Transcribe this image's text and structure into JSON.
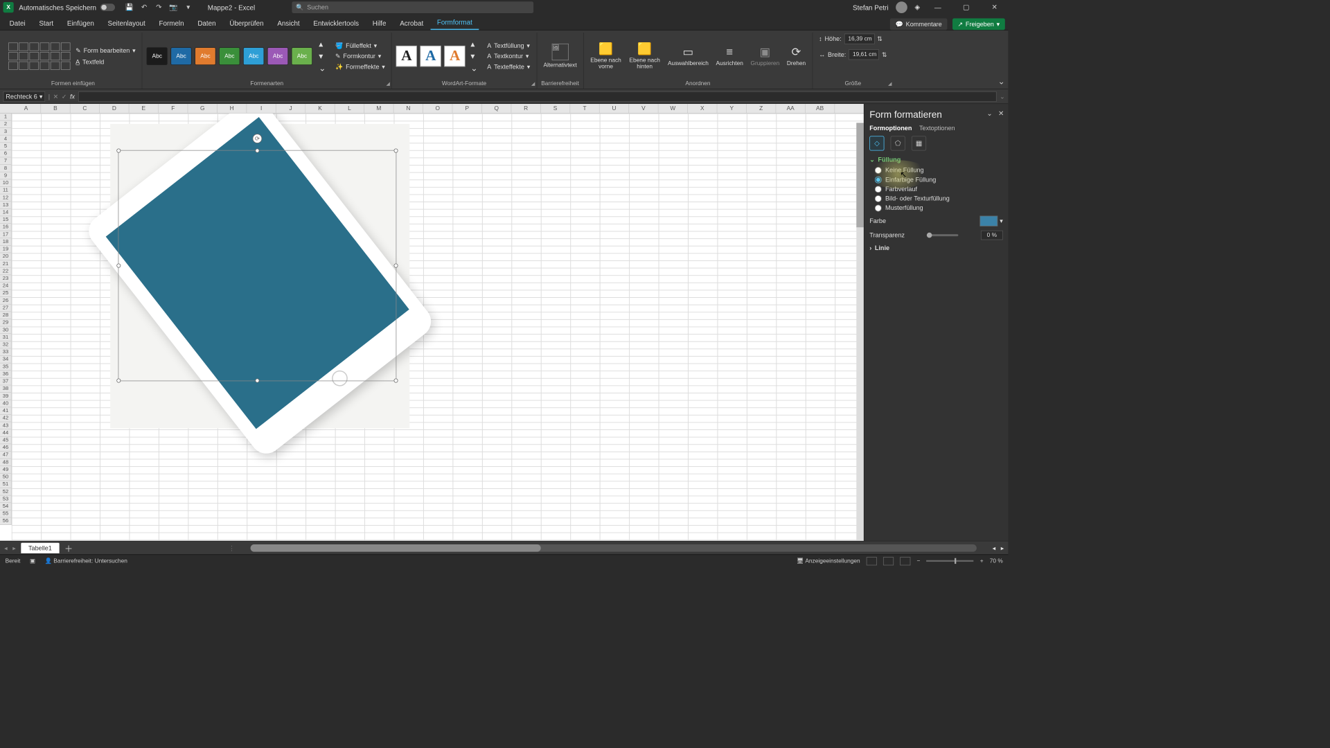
{
  "titlebar": {
    "autosave_label": "Automatisches Speichern",
    "doc_name": "Mappe2 - Excel",
    "search_placeholder": "Suchen",
    "user_name": "Stefan Petri"
  },
  "menu": {
    "tabs": [
      "Datei",
      "Start",
      "Einfügen",
      "Seitenlayout",
      "Formeln",
      "Daten",
      "Überprüfen",
      "Ansicht",
      "Entwicklertools",
      "Hilfe",
      "Acrobat",
      "Formformat"
    ],
    "active": 11,
    "comments": "Kommentare",
    "share": "Freigeben"
  },
  "ribbon": {
    "g_shapes": {
      "label": "Formen einfügen",
      "edit_shape": "Form bearbeiten",
      "textfield": "Textfeld"
    },
    "g_styles": {
      "label": "Formenarten",
      "swatches": [
        {
          "bg": "#1b1b1b",
          "txt": "Abc"
        },
        {
          "bg": "#1f6aa5",
          "txt": "Abc"
        },
        {
          "bg": "#e07b2e",
          "txt": "Abc"
        },
        {
          "bg": "#3a8f3a",
          "txt": "Abc"
        },
        {
          "bg": "#2e9fd6",
          "txt": "Abc"
        },
        {
          "bg": "#9b59b6",
          "txt": "Abc"
        },
        {
          "bg": "#6ab04c",
          "txt": "Abc"
        }
      ],
      "fill": "Fülleffekt",
      "outline": "Formkontur",
      "effects": "Formeffekte"
    },
    "g_wordart": {
      "label": "WordArt-Formate",
      "textfill": "Textfüllung",
      "textoutline": "Textkontur",
      "texteffects": "Texteffekte"
    },
    "g_alt": {
      "label": "Barrierefreiheit",
      "btn": "Alternativtext"
    },
    "g_arrange": {
      "label": "Anordnen",
      "forward": "Ebene nach vorne",
      "backward": "Ebene nach hinten",
      "selection": "Auswahlbereich",
      "align": "Ausrichten",
      "group": "Gruppieren",
      "rotate": "Drehen"
    },
    "g_size": {
      "label": "Größe",
      "height_label": "Höhe:",
      "height_value": "16,39 cm",
      "width_label": "Breite:",
      "width_value": "19,61 cm"
    }
  },
  "formula": {
    "namebox": "Rechteck 6"
  },
  "columns": [
    "A",
    "B",
    "C",
    "D",
    "E",
    "F",
    "G",
    "H",
    "I",
    "J",
    "K",
    "L",
    "M",
    "N",
    "O",
    "P",
    "Q",
    "R",
    "S",
    "T",
    "U",
    "V",
    "W",
    "X",
    "Y",
    "Z",
    "AA",
    "AB"
  ],
  "sidepanel": {
    "title": "Form formatieren",
    "tab_shape": "Formoptionen",
    "tab_text": "Textoptionen",
    "section_fill": "Füllung",
    "fill_options": {
      "none": "Keine Füllung",
      "solid": "Einfarbige Füllung",
      "gradient": "Farbverlauf",
      "picture": "Bild- oder Texturfüllung",
      "pattern": "Musterfüllung"
    },
    "color_label": "Farbe",
    "transparency_label": "Transparenz",
    "transparency_value": "0 %",
    "section_line": "Linie"
  },
  "sheettabs": {
    "tab1": "Tabelle1"
  },
  "status": {
    "ready": "Bereit",
    "accessibility": "Barrierefreiheit: Untersuchen",
    "display": "Anzeigeeinstellungen",
    "zoom": "70 %"
  }
}
